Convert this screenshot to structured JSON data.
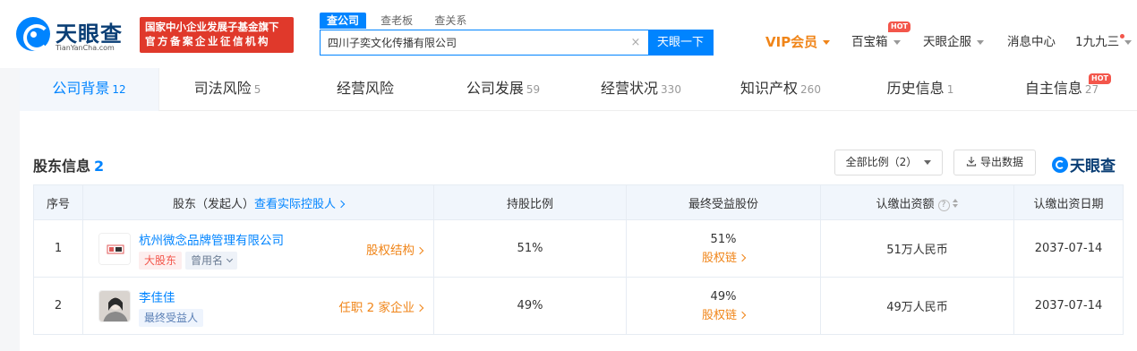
{
  "header": {
    "logo_text": "天眼查",
    "logo_sub": "TianYanCha.com",
    "banner_line1": "国家中小企业发展子基金旗下",
    "banner_line2": "官方备案企业征信机构",
    "search_tabs": [
      "查公司",
      "查老板",
      "查关系"
    ],
    "search_value": "四川子奕文化传播有限公司",
    "search_clear": "×",
    "search_button": "天眼一下",
    "nav": {
      "vip": "VIP会员",
      "toolbox": "百宝箱",
      "toolbox_badge": "HOT",
      "enterprise": "天眼企服",
      "messages": "消息中心",
      "user": "1九九三"
    }
  },
  "tabs": [
    {
      "label": "公司背景",
      "count": "12",
      "active": true
    },
    {
      "label": "司法风险",
      "count": "5"
    },
    {
      "label": "经营风险",
      "count": ""
    },
    {
      "label": "公司发展",
      "count": "59"
    },
    {
      "label": "经营状况",
      "count": "330"
    },
    {
      "label": "知识产权",
      "count": "260"
    },
    {
      "label": "历史信息",
      "count": "1"
    },
    {
      "label": "自主信息",
      "count": "27",
      "badge": "HOT"
    }
  ],
  "section": {
    "title": "股东信息",
    "count": "2",
    "ratio_filter": "全部比例（2）",
    "export_label": "导出数据",
    "brand": "天眼查"
  },
  "table": {
    "headers": {
      "index": "序号",
      "holder": "股东（发起人）",
      "holder_link": "查看实际控股人",
      "ratio": "持股比例",
      "final": "最终受益股份",
      "capital": "认缴出资额",
      "help": "?",
      "date": "认缴出资日期"
    },
    "rows": [
      {
        "index": "1",
        "name": "杭州微念品牌管理有限公司",
        "tags": [
          "大股东",
          "曾用名"
        ],
        "action": "股权结构",
        "ratio": "51%",
        "final_ratio": "51%",
        "final_link": "股权链",
        "capital": "51万人民币",
        "date": "2037-07-14"
      },
      {
        "index": "2",
        "name": "李佳佳",
        "tags": [
          "最终受益人"
        ],
        "action": "任职 2 家企业",
        "ratio": "49%",
        "final_ratio": "49%",
        "final_link": "股权链",
        "capital": "49万人民币",
        "date": "2037-07-14"
      }
    ]
  },
  "colors": {
    "brand_blue": "#0084ff",
    "accent_orange": "#f08519",
    "hot_red": "#f3564b",
    "banner_red": "#e0392b"
  }
}
